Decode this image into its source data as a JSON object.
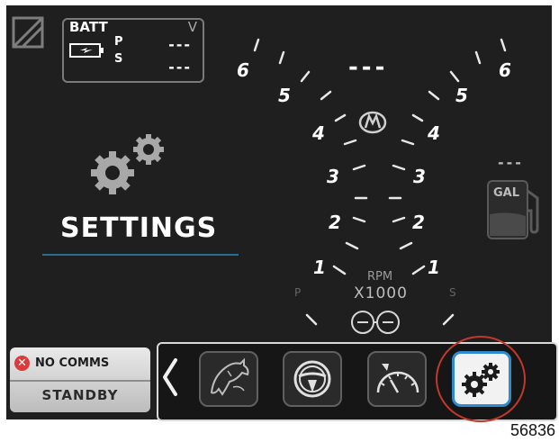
{
  "battery": {
    "title": "BATT",
    "unit": "V",
    "port_label": "P",
    "starboard_label": "S",
    "port_value": "---",
    "starboard_value": "---"
  },
  "settings_label": "SETTINGS",
  "center_display": "---",
  "fuel": {
    "value": "---",
    "unit": "GAL"
  },
  "tachometer": {
    "label": "RPM",
    "multiplier": "X1000",
    "port_side": "P",
    "starboard_side": "S",
    "scale": [
      "1",
      "2",
      "3",
      "4",
      "5",
      "6"
    ]
  },
  "status": {
    "comms": "NO COMMS",
    "mode": "STANDBY"
  },
  "nav": {
    "items": [
      "back",
      "eco-mode",
      "helm",
      "gauge",
      "settings"
    ],
    "active": "settings"
  },
  "figure_id": "56836",
  "colors": {
    "background": "#1f1f1f",
    "accent_blue": "#2f8bd0",
    "alert_red": "#d93c3c",
    "highlight_ring": "#c0392b"
  }
}
